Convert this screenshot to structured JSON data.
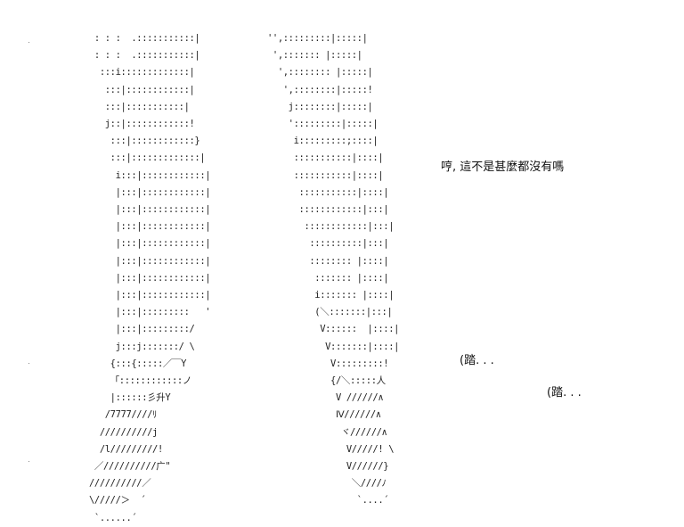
{
  "art": {
    "left_leg": [
      " : : :  .:::::::::::|",
      " : : :  .:::::::::::|",
      "  :::i:::::::::::::|",
      "   :::|::::::::::::|",
      "   :::|:::::::::::|",
      "   j::|::::::::::::!",
      "    :::|::::::::::::}",
      "    :::|:::::::::::::|",
      "     i:::|::::::::::::|",
      "     |:::|::::::::::::|",
      "     |:::|::::::::::::|",
      "     |:::|::::::::::::|",
      "     |:::|::::::::::::|",
      "     |:::|::::::::::::|",
      "     |:::|::::::::::::|",
      "     |:::|::::::::::::|",
      "     |:::|:::::::::   '",
      "     |:::|:::::::::/",
      "     j:::j:::::::/ \\",
      "    {:::{:::::／￣Y",
      "    「::::::::::::ノ",
      "    |::::::彡升Y",
      "   /7777////ﾘ",
      "  //////////j",
      "  /l/////////!",
      " ／//////////广\"",
      "//////////／",
      "\\/////＞  ´",
      " `......´"
    ],
    "right_leg": [
      "'',:::::::::|:::::|",
      " ',::::::: |:::::|",
      "  ',:::::::: |:::::|",
      "   ',::::::::|:::::!",
      "    j::::::::|:::::|",
      "    ':::::::::|:::::|",
      "     i:::::::::;::::|",
      "     :::::::::::|::::|",
      "     :::::::::::|::::|",
      "      :::::::::::|::::|",
      "      ::::::::::::|:::|",
      "       ::::::::::::|:::|",
      "        ::::::::::|:::|",
      "        :::::::: |::::|",
      "         ::::::: |::::|",
      "         i::::::: |::::|",
      "         (＼:::::::|:::|",
      "          V::::::  |::::|",
      "           V:::::::|::::|",
      "            V:::::::::!",
      "            {/＼:::::人",
      "             V //////∧",
      "             Ⅳ//////∧",
      "              ヾ//////∧",
      "               V/////! \\",
      "               V//////}",
      "                ＼////ﾉ",
      "                 `....´"
    ]
  },
  "speech": {
    "line": "哼, 這不是甚麼都沒有嗎"
  },
  "sounds": {
    "step_1": "(踏. . .",
    "step_2": "(踏. . ."
  }
}
